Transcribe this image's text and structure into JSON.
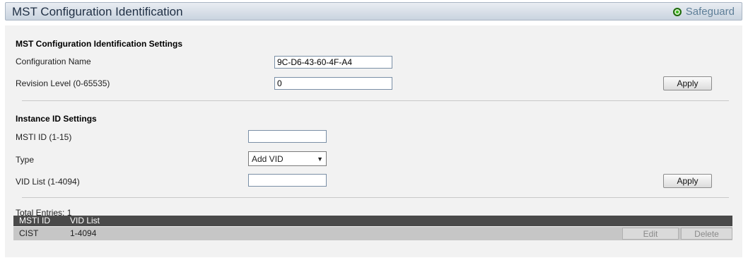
{
  "header": {
    "title": "MST Configuration Identification",
    "safeguard_label": "Safeguard",
    "safeguard_color": "#39b51d"
  },
  "mst_settings": {
    "section_title": "MST Configuration Identification Settings",
    "config_name_label": "Configuration Name",
    "config_name_value": "9C-D6-43-60-4F-A4",
    "revision_label": "Revision Level (0-65535)",
    "revision_value": "0",
    "apply_label": "Apply"
  },
  "instance_settings": {
    "section_title": "Instance ID Settings",
    "msti_label": "MSTI ID (1-15)",
    "msti_value": "",
    "type_label": "Type",
    "type_selected": "Add VID",
    "vid_label": "VID List (1-4094)",
    "vid_value": "",
    "apply_label": "Apply"
  },
  "table": {
    "total_entries": "Total Entries: 1",
    "columns": [
      "MSTI ID",
      "VID List"
    ],
    "rows": [
      {
        "msti_id": "CIST",
        "vid_list": "1-4094",
        "edit_label": "Edit",
        "delete_label": "Delete"
      }
    ]
  }
}
